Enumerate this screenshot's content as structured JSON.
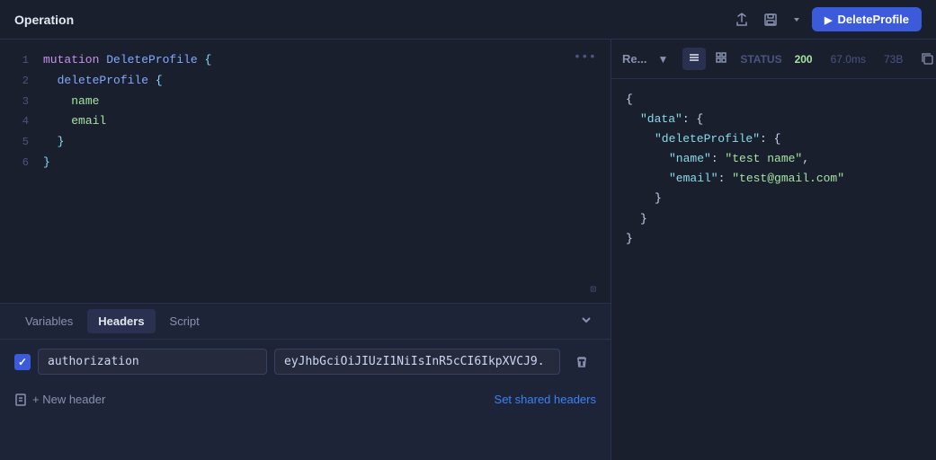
{
  "topBar": {
    "title": "Operation",
    "runButtonLabel": "DeleteProfile",
    "icons": [
      "upload-icon",
      "save-icon",
      "chevron-down-icon"
    ]
  },
  "editor": {
    "lines": [
      {
        "num": 1,
        "tokens": [
          {
            "type": "kw",
            "text": "mutation "
          },
          {
            "type": "name",
            "text": "DeleteProfile"
          },
          {
            "type": "plain",
            "text": " {"
          }
        ]
      },
      {
        "num": 2,
        "tokens": [
          {
            "type": "plain",
            "text": "  "
          },
          {
            "type": "name",
            "text": "deleteProfile"
          },
          {
            "type": "brace",
            "text": " {"
          }
        ]
      },
      {
        "num": 3,
        "tokens": [
          {
            "type": "plain",
            "text": "    "
          },
          {
            "type": "field",
            "text": "name"
          }
        ]
      },
      {
        "num": 4,
        "tokens": [
          {
            "type": "plain",
            "text": "    "
          },
          {
            "type": "field",
            "text": "email"
          }
        ]
      },
      {
        "num": 5,
        "tokens": [
          {
            "type": "brace",
            "text": "  }"
          }
        ]
      },
      {
        "num": 6,
        "tokens": [
          {
            "type": "brace",
            "text": "}"
          }
        ]
      }
    ],
    "dotsLabel": "•••",
    "bottomIconLabel": "⊡"
  },
  "bottomPanel": {
    "tabs": [
      {
        "label": "Variables",
        "active": false
      },
      {
        "label": "Headers",
        "active": true
      },
      {
        "label": "Script",
        "active": false
      }
    ],
    "headerRows": [
      {
        "checked": true,
        "key": "authorization",
        "value": "eyJhbGciOiJIUzI1NiIsInR5cCI6IkpXVCJ9."
      }
    ],
    "newHeaderLabel": "+ New header",
    "setSharedLabel": "Set shared headers"
  },
  "rightPanel": {
    "responseLabel": "Re...",
    "status": "200",
    "timing": "67.0ms",
    "size": "73B",
    "statusLabel": "STATUS",
    "json": {
      "raw": "{\n  \"data\": {\n    \"deleteProfile\": {\n      \"name\": \"test name\",\n      \"email\": \"test@gmail.com\"\n    }\n  }\n}"
    }
  }
}
